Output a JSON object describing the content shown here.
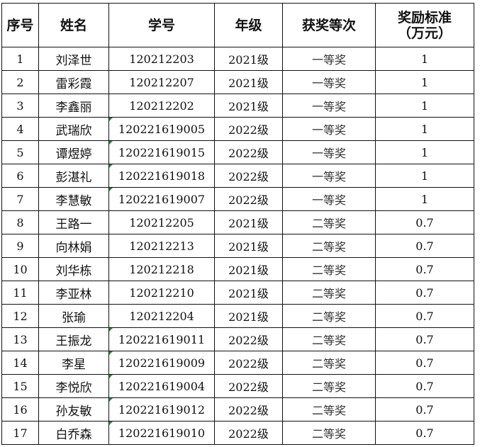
{
  "table": {
    "headers": {
      "index": "序号",
      "name": "姓名",
      "student_id": "学号",
      "grade": "年级",
      "award_level": "获奖等次",
      "amount_line1": "奖励标准",
      "amount_line2": "（万元）"
    },
    "rows": [
      {
        "index": "1",
        "name": "刘泽世",
        "student_id": "120212203",
        "grade": "2021级",
        "award_level": "一等奖",
        "amount": "1"
      },
      {
        "index": "2",
        "name": "雷彩霞",
        "student_id": "120212207",
        "grade": "2021级",
        "award_level": "一等奖",
        "amount": "1"
      },
      {
        "index": "3",
        "name": "李鑫丽",
        "student_id": "120212202",
        "grade": "2021级",
        "award_level": "一等奖",
        "amount": "1"
      },
      {
        "index": "4",
        "name": "武瑞欣",
        "student_id": "120221619005",
        "grade": "2022级",
        "award_level": "一等奖",
        "amount": "1"
      },
      {
        "index": "5",
        "name": "谭煜婷",
        "student_id": "120221619015",
        "grade": "2022级",
        "award_level": "一等奖",
        "amount": "1"
      },
      {
        "index": "6",
        "name": "彭湛礼",
        "student_id": "120221619018",
        "grade": "2022级",
        "award_level": "一等奖",
        "amount": "1"
      },
      {
        "index": "7",
        "name": "李慧敏",
        "student_id": "120221619007",
        "grade": "2022级",
        "award_level": "一等奖",
        "amount": "1"
      },
      {
        "index": "8",
        "name": "王路一",
        "student_id": "120212205",
        "grade": "2021级",
        "award_level": "二等奖",
        "amount": "0.7"
      },
      {
        "index": "9",
        "name": "向林娟",
        "student_id": "120212213",
        "grade": "2021级",
        "award_level": "二等奖",
        "amount": "0.7"
      },
      {
        "index": "10",
        "name": "刘华栋",
        "student_id": "120212218",
        "grade": "2021级",
        "award_level": "二等奖",
        "amount": "0.7"
      },
      {
        "index": "11",
        "name": "李亚林",
        "student_id": "120212210",
        "grade": "2021级",
        "award_level": "二等奖",
        "amount": "0.7"
      },
      {
        "index": "12",
        "name": "张瑜",
        "student_id": "120212204",
        "grade": "2021级",
        "award_level": "二等奖",
        "amount": "0.7"
      },
      {
        "index": "13",
        "name": "王振龙",
        "student_id": "120221619011",
        "grade": "2022级",
        "award_level": "二等奖",
        "amount": "0.7"
      },
      {
        "index": "14",
        "name": "李星",
        "student_id": "120221619009",
        "grade": "2022级",
        "award_level": "二等奖",
        "amount": "0.7"
      },
      {
        "index": "15",
        "name": "李悦欣",
        "student_id": "120221619004",
        "grade": "2022级",
        "award_level": "二等奖",
        "amount": "0.7"
      },
      {
        "index": "16",
        "name": "孙友敏",
        "student_id": "120221619012",
        "grade": "2022级",
        "award_level": "二等奖",
        "amount": "0.7"
      },
      {
        "index": "17",
        "name": "白乔森",
        "student_id": "120221619010",
        "grade": "2022级",
        "award_level": "二等奖",
        "amount": "0.7"
      }
    ]
  }
}
